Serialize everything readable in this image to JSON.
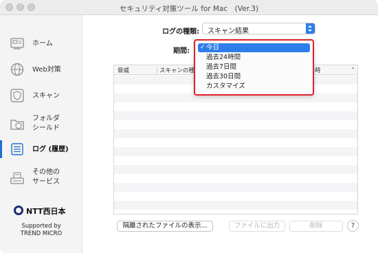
{
  "window": {
    "title": "セキュリティ対策ツール for Mac　(Ver.3)"
  },
  "sidebar": {
    "items": [
      {
        "icon": "home-icon",
        "label_line1": "ホーム",
        "label_line2": ""
      },
      {
        "icon": "globe-icon",
        "label_line1": "Web対策",
        "label_line2": ""
      },
      {
        "icon": "shield-scan-icon",
        "label_line1": "スキャン",
        "label_line2": ""
      },
      {
        "icon": "folder-shield-icon",
        "label_line1": "フォルダ",
        "label_line2": "シールド"
      },
      {
        "icon": "log-list-icon",
        "label_line1": "ログ (履歴)",
        "label_line2": ""
      },
      {
        "icon": "other-services-icon",
        "label_line1": "その他の",
        "label_line2": "サービス"
      }
    ],
    "active_index": 4,
    "logo_text": "NTT西日本",
    "supported_line1": "Supported by",
    "supported_line2": "TREND MICRO"
  },
  "filters": {
    "log_type_label": "ログの種類:",
    "log_type_value": "スキャン結果",
    "period_label": "期間:"
  },
  "table": {
    "columns": [
      "脅威",
      "スキャンの種類",
      "時"
    ]
  },
  "period_dropdown": {
    "options": [
      "今日",
      "過去24時間",
      "過去7日間",
      "過去30日間",
      "カスタマイズ"
    ],
    "selected_index": 0,
    "check_glyph": "✓"
  },
  "buttons": {
    "show_quarantine": "隔離されたファイルの表示...",
    "export_file": "ファイルに出力",
    "delete": "削除",
    "help": "?"
  },
  "colors": {
    "accent": "#2f7de9",
    "highlight_border": "#e0202a",
    "active_indicator": "#1f6fd1"
  }
}
